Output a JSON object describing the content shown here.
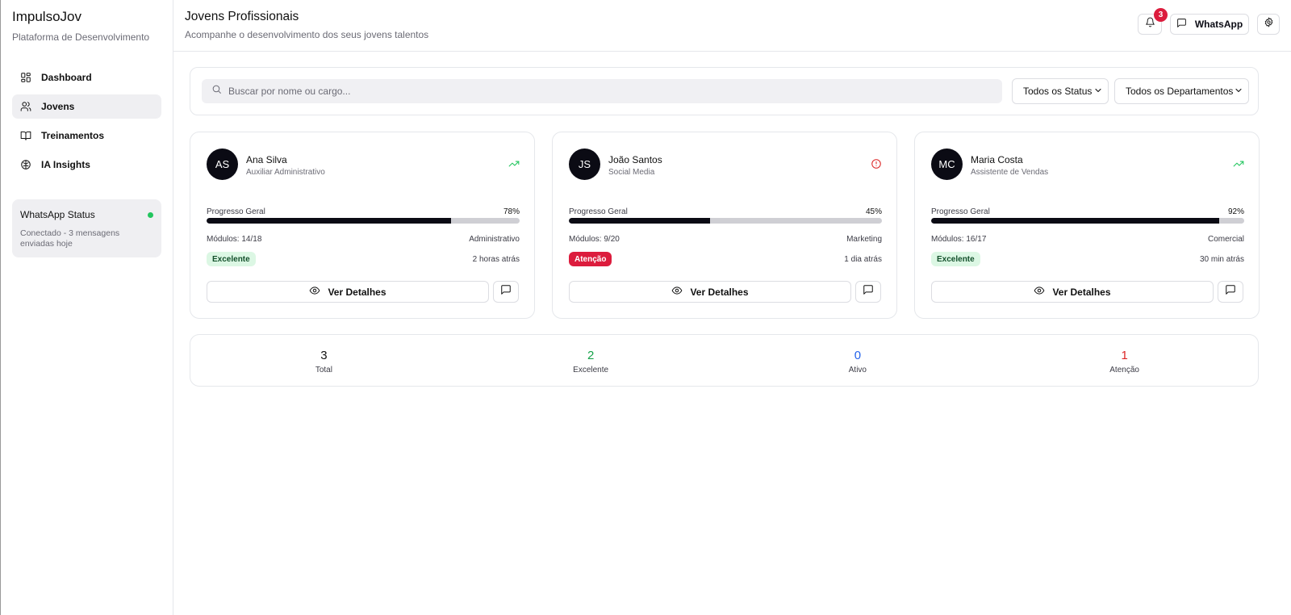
{
  "sidebar": {
    "brand_title": "ImpulsoJov",
    "brand_subtitle": "Plataforma de Desenvolvimento",
    "items": [
      {
        "label": "Dashboard",
        "icon": "layout-grid-icon",
        "active": false
      },
      {
        "label": "Jovens",
        "icon": "users-icon",
        "active": true
      },
      {
        "label": "Treinamentos",
        "icon": "book-open-icon",
        "active": false
      },
      {
        "label": "IA Insights",
        "icon": "brain-icon",
        "active": false
      }
    ],
    "whatsapp_status": {
      "title": "WhatsApp Status",
      "description": "Conectado - 3 mensagens enviadas hoje",
      "indicator_color": "#22c55e"
    }
  },
  "header": {
    "title": "Jovens Profissionais",
    "subtitle": "Acompanhe o desenvolvimento dos seus jovens talentos",
    "notifications_count": "3",
    "whatsapp_label": "WhatsApp"
  },
  "filters": {
    "search_placeholder": "Buscar por nome ou cargo...",
    "status_selected": "Todos os Status",
    "department_selected": "Todos os Departamentos"
  },
  "cards": [
    {
      "initials": "AS",
      "name": "Ana Silva",
      "role": "Auxiliar Administrativo",
      "trend_icon": "trending-up-icon",
      "progress_label": "Progresso Geral",
      "progress_value": "78%",
      "progress": 78,
      "modules": "Módulos: 14/18",
      "department": "Administrativo",
      "status": "Excelente",
      "status_type": "good",
      "last_activity": "2 horas atrás",
      "details_label": "Ver Detalhes"
    },
    {
      "initials": "JS",
      "name": "João Santos",
      "role": "Social Media",
      "trend_icon": "alert-circle-icon",
      "progress_label": "Progresso Geral",
      "progress_value": "45%",
      "progress": 45,
      "modules": "Módulos: 9/20",
      "department": "Marketing",
      "status": "Atenção",
      "status_type": "warn",
      "last_activity": "1 dia atrás",
      "details_label": "Ver Detalhes"
    },
    {
      "initials": "MC",
      "name": "Maria Costa",
      "role": "Assistente de Vendas",
      "trend_icon": "trending-up-icon",
      "progress_label": "Progresso Geral",
      "progress_value": "92%",
      "progress": 92,
      "modules": "Módulos: 16/17",
      "department": "Comercial",
      "status": "Excelente",
      "status_type": "good",
      "last_activity": "30 min atrás",
      "details_label": "Ver Detalhes"
    }
  ],
  "stats": [
    {
      "value": "3",
      "label": "Total",
      "color": "#111111"
    },
    {
      "value": "2",
      "label": "Excelente",
      "color": "#16a34a"
    },
    {
      "value": "0",
      "label": "Ativo",
      "color": "#2563eb"
    },
    {
      "value": "1",
      "label": "Atenção",
      "color": "#dc2626"
    }
  ],
  "colors": {
    "trend_up": "#22c55e",
    "alert": "#dc2626",
    "badge_red": "#dc1c3d"
  }
}
